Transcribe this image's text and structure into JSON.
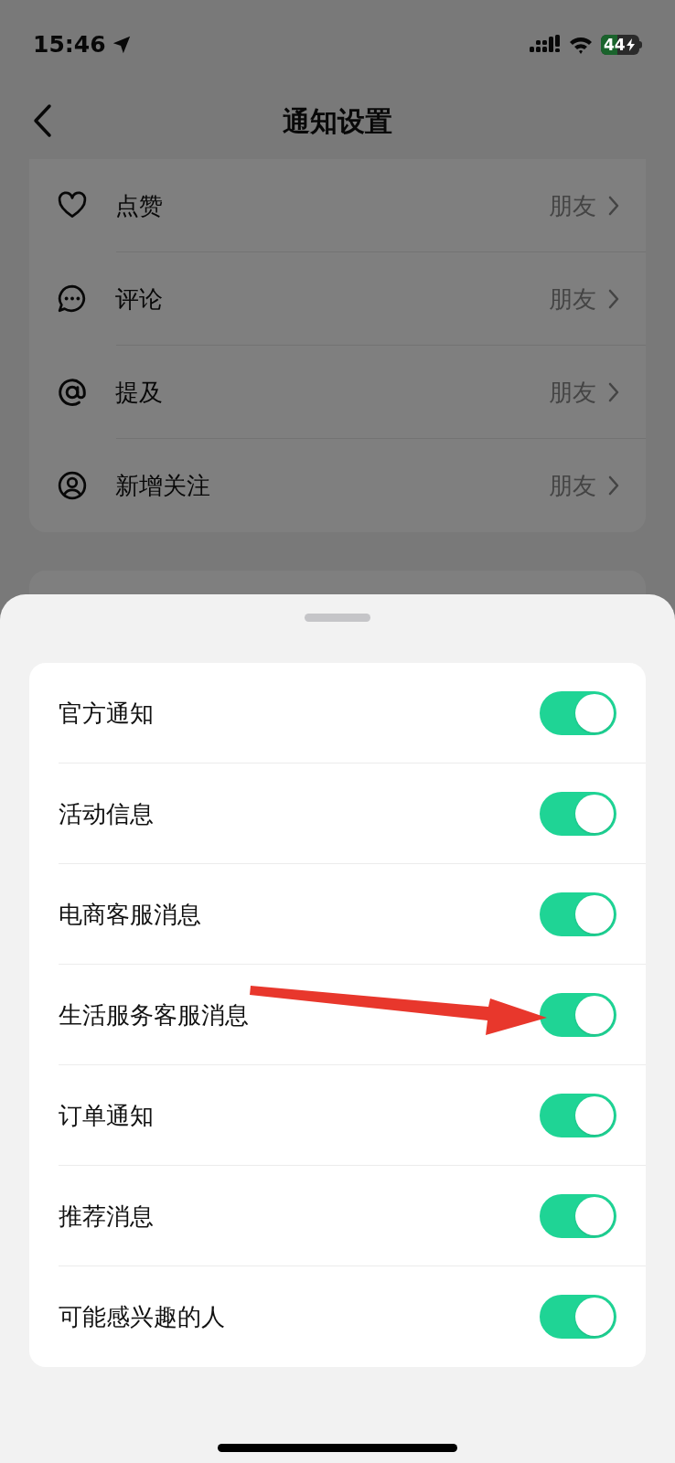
{
  "status_bar": {
    "time": "15:46",
    "battery": "44"
  },
  "nav": {
    "title": "通知设置"
  },
  "interaction_settings": [
    {
      "kind": "heart",
      "label": "点赞",
      "value": "朋友"
    },
    {
      "kind": "comment",
      "label": "评论",
      "value": "朋友"
    },
    {
      "kind": "mention",
      "label": "提及",
      "value": "朋友"
    },
    {
      "kind": "follower",
      "label": "新增关注",
      "value": "朋友"
    }
  ],
  "sheet": {
    "toggles": [
      {
        "label": "官方通知",
        "on": true
      },
      {
        "label": "活动信息",
        "on": true
      },
      {
        "label": "电商客服消息",
        "on": true
      },
      {
        "label": "生活服务客服消息",
        "on": true
      },
      {
        "label": "订单通知",
        "on": true
      },
      {
        "label": "推荐消息",
        "on": true
      },
      {
        "label": "可能感兴趣的人",
        "on": true
      }
    ]
  }
}
